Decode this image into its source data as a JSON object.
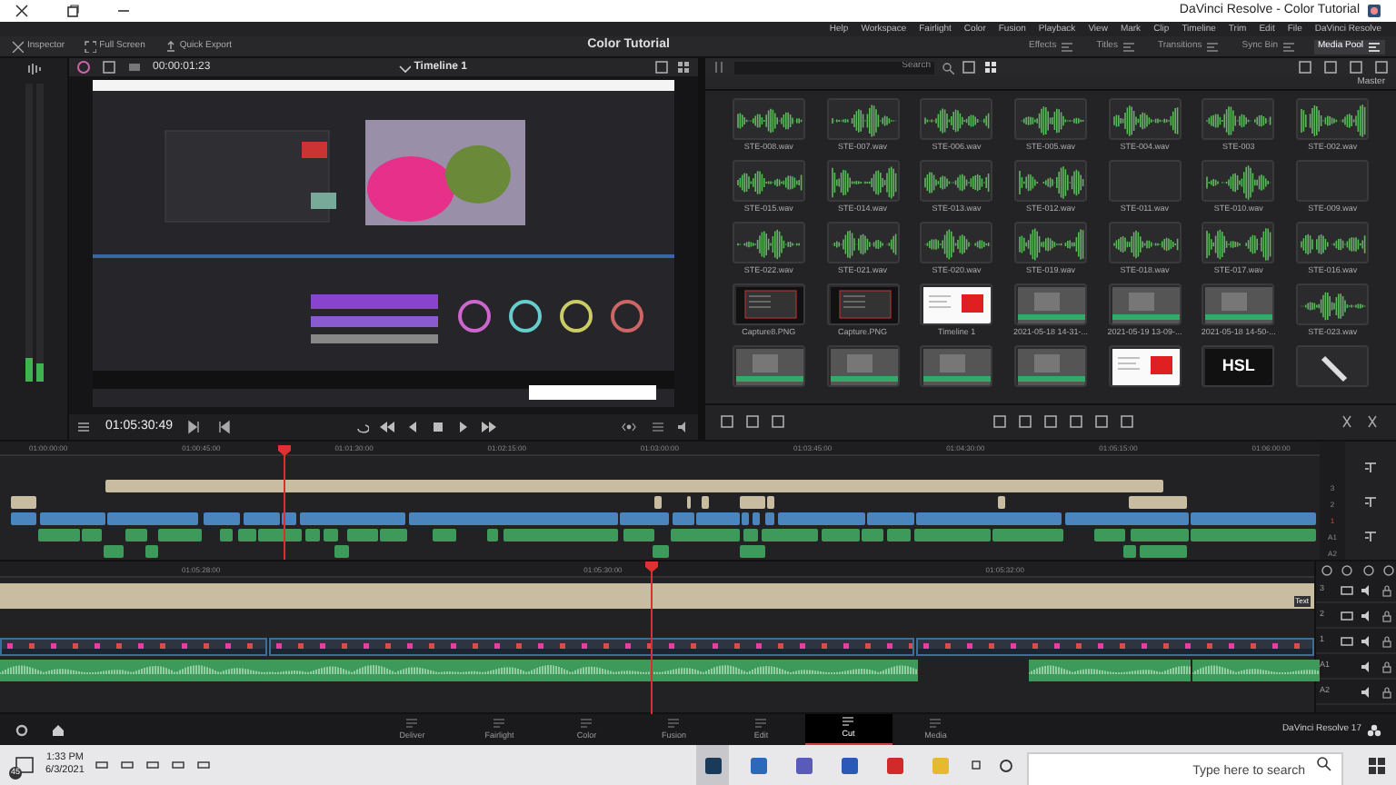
{
  "window": {
    "title": "DaVinci Resolve - Color Tutorial"
  },
  "menu": [
    "Help",
    "Workspace",
    "Fairlight",
    "Color",
    "Fusion",
    "Playback",
    "View",
    "Mark",
    "Clip",
    "Timeline",
    "Trim",
    "Edit",
    "File",
    "DaVinci Resolve"
  ],
  "toolbar": {
    "actions": [
      "Inspector",
      "Full Screen",
      "Quick Export"
    ],
    "project_title": "Color Tutorial",
    "panels": [
      {
        "label": "Effects",
        "selected": false
      },
      {
        "label": "Titles",
        "selected": false
      },
      {
        "label": "Transitions",
        "selected": false
      },
      {
        "label": "Sync Bin",
        "selected": false
      },
      {
        "label": "Media Pool",
        "selected": true
      }
    ]
  },
  "viewer": {
    "timecode": "00:00:01:23",
    "timeline_name": "Timeline 1",
    "transport_timecode": "01:05:30:49"
  },
  "media_pool": {
    "search": {
      "placeholder": "Search"
    },
    "bin": "Master",
    "clips": [
      {
        "name": "STE-008.wav",
        "kind": "audio"
      },
      {
        "name": "STE-007.wav",
        "kind": "audio"
      },
      {
        "name": "STE-006.wav",
        "kind": "audio"
      },
      {
        "name": "STE-005.wav",
        "kind": "audio"
      },
      {
        "name": "STE-004.wav",
        "kind": "audio"
      },
      {
        "name": "STE-003",
        "kind": "audio"
      },
      {
        "name": "STE-002.wav",
        "kind": "audio"
      },
      {
        "name": "STE-015.wav",
        "kind": "audio"
      },
      {
        "name": "STE-014.wav",
        "kind": "audio"
      },
      {
        "name": "STE-013.wav",
        "kind": "audio"
      },
      {
        "name": "STE-012.wav",
        "kind": "audio"
      },
      {
        "name": "STE-011.wav",
        "kind": "blank"
      },
      {
        "name": "STE-010.wav",
        "kind": "audio"
      },
      {
        "name": "STE-009.wav",
        "kind": "blank"
      },
      {
        "name": "STE-022.wav",
        "kind": "audio"
      },
      {
        "name": "STE-021.wav",
        "kind": "audio"
      },
      {
        "name": "STE-020.wav",
        "kind": "audio"
      },
      {
        "name": "STE-019.wav",
        "kind": "audio"
      },
      {
        "name": "STE-018.wav",
        "kind": "audio"
      },
      {
        "name": "STE-017.wav",
        "kind": "audio"
      },
      {
        "name": "STE-016.wav",
        "kind": "audio"
      },
      {
        "name": "Capture8.PNG",
        "kind": "image"
      },
      {
        "name": "Capture.PNG",
        "kind": "image"
      },
      {
        "name": "Timeline 1",
        "kind": "timeline"
      },
      {
        "name": "2021-05-18 14-31-...",
        "kind": "video"
      },
      {
        "name": "2021-05-19 13-09-...",
        "kind": "video"
      },
      {
        "name": "2021-05-18 14-50-...",
        "kind": "video"
      },
      {
        "name": "STE-023.wav",
        "kind": "audio"
      },
      {
        "kind": "video"
      },
      {
        "kind": "video"
      },
      {
        "kind": "video"
      },
      {
        "kind": "video"
      },
      {
        "kind": "timeline"
      },
      {
        "kind": "hsl",
        "name": "HSL"
      },
      {
        "kind": "tool"
      }
    ]
  },
  "upper_timeline": {
    "ruler": [
      "01:00:00:00",
      "01:00:45:00",
      "01:01:30:00",
      "01:02:15:00",
      "01:03:00:00",
      "01:03:45:00",
      "01:04:30:00",
      "01:05:15:00",
      "01:06:00:00"
    ],
    "tracks": [
      {
        "label": "3",
        "selected": false
      },
      {
        "label": "2",
        "selected": false
      },
      {
        "label": "1",
        "selected": true
      },
      {
        "label": "A1",
        "selected": false
      },
      {
        "label": "A2",
        "selected": false
      }
    ]
  },
  "lower_timeline": {
    "ruler": [
      "01:05:28:00",
      "01:05:30:00",
      "01:05:32:00"
    ],
    "title_clip": "Text",
    "tracks": [
      {
        "label": "3"
      },
      {
        "label": "2"
      },
      {
        "label": "1"
      },
      {
        "label": "A1"
      },
      {
        "label": "A2"
      }
    ]
  },
  "pages": [
    {
      "label": "Deliver",
      "selected": false
    },
    {
      "label": "Fairlight",
      "selected": false
    },
    {
      "label": "Color",
      "selected": false
    },
    {
      "label": "Fusion",
      "selected": false
    },
    {
      "label": "Edit",
      "selected": false
    },
    {
      "label": "Cut",
      "selected": true
    },
    {
      "label": "Media",
      "selected": false
    }
  ],
  "app_name": "DaVinci Resolve 17",
  "taskbar": {
    "search": {
      "placeholder": "Type here to search"
    },
    "time": "1:33 PM",
    "date": "6/3/2021",
    "notifications": "45"
  }
}
